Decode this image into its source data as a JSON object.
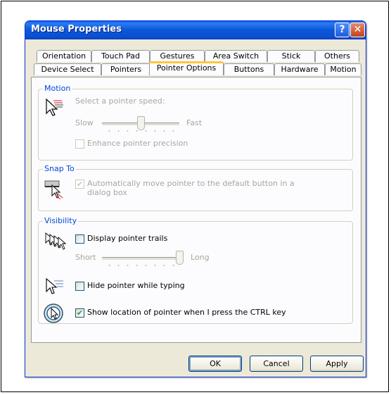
{
  "window": {
    "title": "Mouse Properties",
    "help_glyph": "?",
    "close_glyph": "✕"
  },
  "tabs_row1": [
    "Orientation",
    "Touch Pad",
    "Gestures",
    "Area Switch",
    "Stick",
    "Others"
  ],
  "tabs_row2": [
    "Device Select",
    "Pointers",
    "Pointer Options",
    "Buttons",
    "Hardware",
    "Motion"
  ],
  "active_tab": "Pointer Options",
  "motion": {
    "legend": "Motion",
    "speed_label": "Select a pointer speed:",
    "slow": "Slow",
    "fast": "Fast",
    "speed_value": 0.5,
    "precision_label": "Enhance pointer precision",
    "precision_checked": false
  },
  "snap": {
    "legend": "Snap To",
    "label_line1": "Automatically move pointer to the default button in a",
    "label_line2": "dialog box",
    "checked": true
  },
  "visibility": {
    "legend": "Visibility",
    "trails_label": "Display pointer trails",
    "trails_checked": false,
    "short": "Short",
    "long": "Long",
    "trail_length": 1.0,
    "hide_label": "Hide pointer while typing",
    "hide_checked": false,
    "ctrl_label": "Show location of pointer when I press the CTRL key",
    "ctrl_checked": true
  },
  "buttons": {
    "ok": "OK",
    "cancel": "Cancel",
    "apply": "Apply"
  },
  "check_glyph": "✔",
  "colors": {
    "titlebar": "#0a5fe8",
    "dialog_bg": "#ece9d8",
    "legend": "#0046d5",
    "check": "#21a121"
  }
}
